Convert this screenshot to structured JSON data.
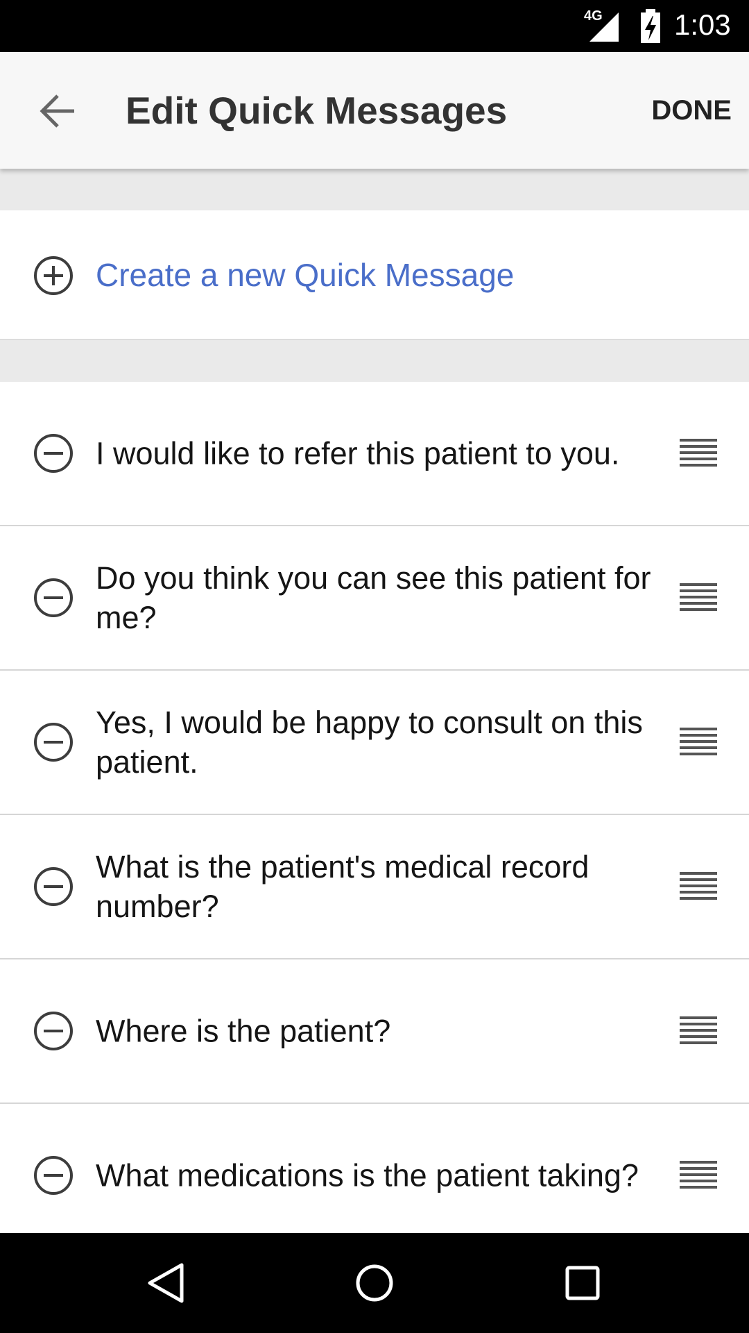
{
  "status": {
    "network": "4G",
    "time": "1:03"
  },
  "header": {
    "title": "Edit Quick Messages",
    "done_label": "DONE"
  },
  "create": {
    "label": "Create a new Quick Message"
  },
  "messages": [
    {
      "text": "I would like to refer this patient to you."
    },
    {
      "text": "Do you think you can see this patient for me?"
    },
    {
      "text": "Yes, I would be happy to consult on this patient."
    },
    {
      "text": "What is the patient's medical record number?"
    },
    {
      "text": "Where is the patient?"
    },
    {
      "text": "What medications is the patient taking?"
    }
  ],
  "colors": {
    "accent": "#4a6ec9",
    "app_bar": "#f7f7f7",
    "separator": "#eaeaea"
  },
  "icons": {
    "back": "arrow-back-icon",
    "add": "add-circle-icon",
    "remove": "remove-circle-icon",
    "reorder": "drag-handle-icon",
    "nav_back": "nav-back-icon",
    "nav_home": "nav-home-icon",
    "nav_recents": "nav-recents-icon"
  }
}
